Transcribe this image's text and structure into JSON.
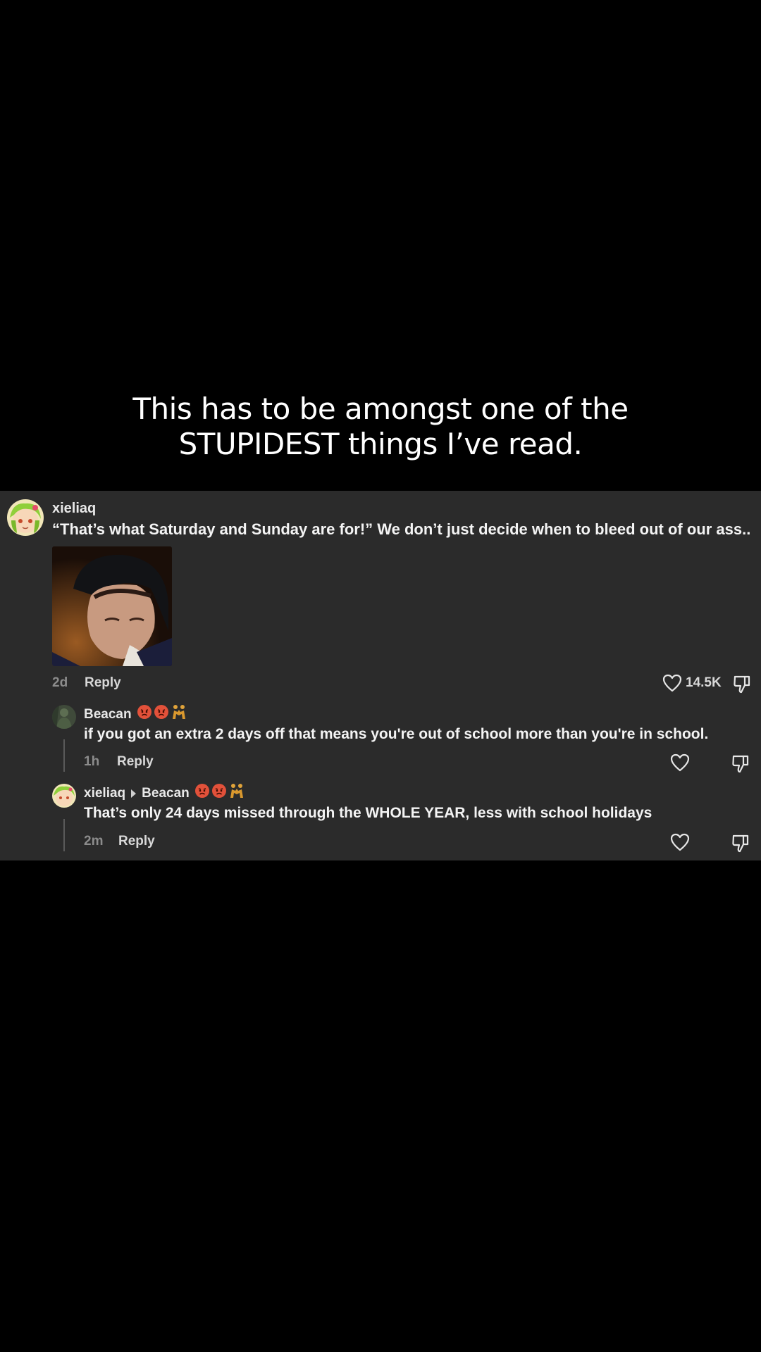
{
  "caption": {
    "line1": "This has to be amongst one of the",
    "line2": "STUPIDEST things I’ve read."
  },
  "comment": {
    "username": "xieliaq",
    "text": "“That’s what Saturday and Sunday are for!” We don’t just decide when to bleed out of our ass..",
    "time": "2d",
    "reply_label": "Reply",
    "like_count": "14.5K"
  },
  "replies": [
    {
      "username": "Beacan",
      "text": "if you got an extra 2 days off that means you're out of school more than you're in school.",
      "time": "1h",
      "reply_label": "Reply"
    },
    {
      "username": "xieliaq",
      "reply_to": "Beacan",
      "text": "That’s only 24 days missed through the WHOLE YEAR, less with school holidays",
      "time": "2m",
      "reply_label": "Reply"
    }
  ],
  "icons": {
    "like": "heart-icon",
    "dislike": "thumbs-down-icon",
    "reply_arrow": "caret-right-icon",
    "emoji": "angry-face-emoji, people-wrestling-emoji"
  },
  "colors": {
    "panel": "#2b2b2b",
    "background": "#000000",
    "muted": "#8c8c8c"
  }
}
